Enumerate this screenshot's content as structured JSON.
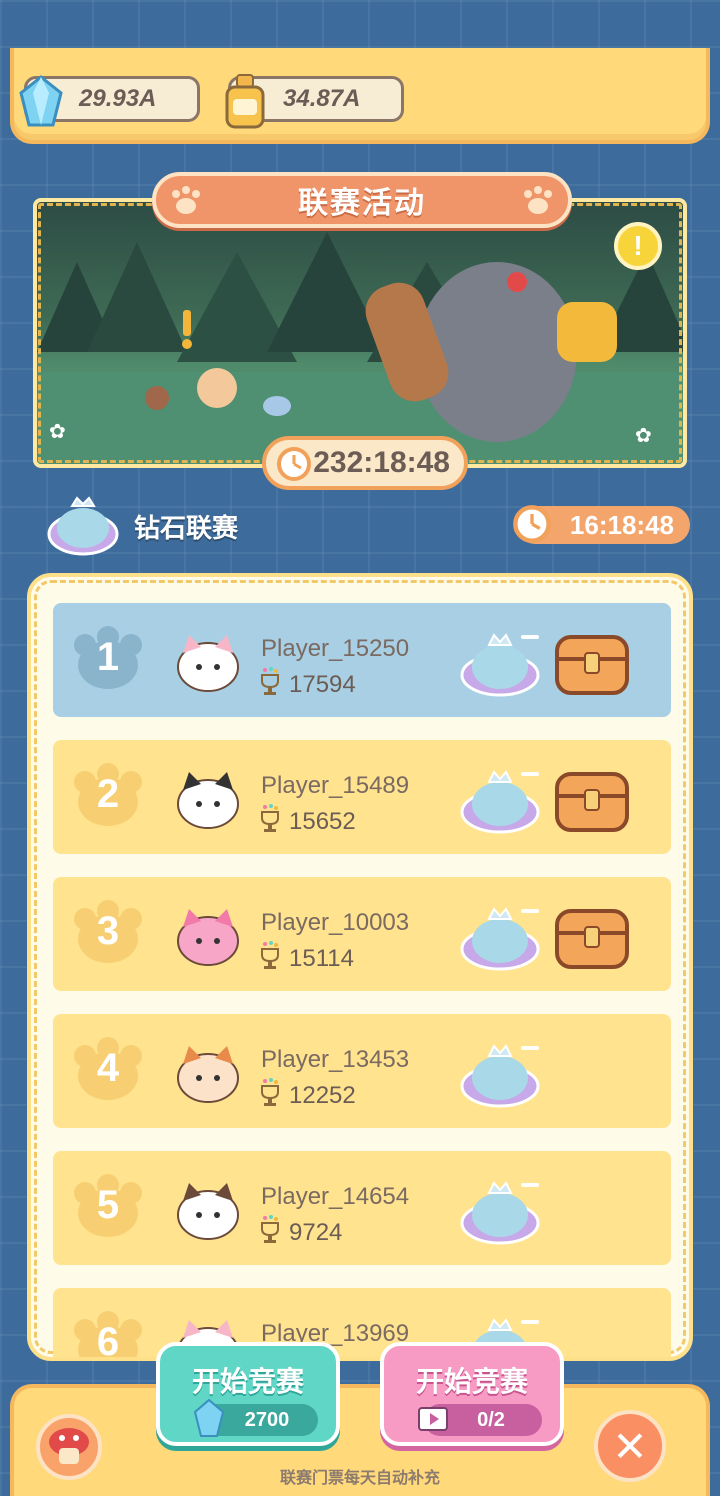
{
  "currencies": [
    {
      "name": "diamond",
      "value": "29.93A",
      "icon": "diamond-icon"
    },
    {
      "name": "potion",
      "value": "34.87A",
      "icon": "potion-bottle-icon"
    }
  ],
  "event": {
    "title": "联赛活动",
    "countdown": "232:18:48"
  },
  "league": {
    "name": "钻石联赛",
    "countdown": "16:18:48"
  },
  "leaderboard": [
    {
      "rank": "1",
      "name": "Player_15250",
      "score": "17594",
      "avatar": "bunny-avatar",
      "highlight": true,
      "chest": true
    },
    {
      "rank": "2",
      "name": "Player_15489",
      "score": "15652",
      "avatar": "tuxedo-cat-avatar",
      "highlight": false,
      "chest": true
    },
    {
      "rank": "3",
      "name": "Player_10003",
      "score": "15114",
      "avatar": "pink-cat-avatar",
      "highlight": false,
      "chest": true
    },
    {
      "rank": "4",
      "name": "Player_13453",
      "score": "12252",
      "avatar": "calico-cat-avatar",
      "highlight": false,
      "chest": false
    },
    {
      "rank": "5",
      "name": "Player_14654",
      "score": "9724",
      "avatar": "panda-avatar",
      "highlight": false,
      "chest": false
    },
    {
      "rank": "6",
      "name": "Player_13969",
      "score": "",
      "avatar": "bunny-avatar",
      "highlight": false,
      "chest": false
    }
  ],
  "buttons": {
    "start_gems": {
      "label": "开始竞赛",
      "cost": "2700"
    },
    "start_video": {
      "label": "开始竞赛",
      "cost": "0/2"
    }
  },
  "refill_note": "联赛门票每天自动补充",
  "colors": {
    "background": "#3d6c9c",
    "panel": "#ffd97a",
    "row": "#ffe38f",
    "row_highlight": "#a8cfe3",
    "teal_button": "#5fd6c6",
    "pink_button": "#f79ac4"
  }
}
